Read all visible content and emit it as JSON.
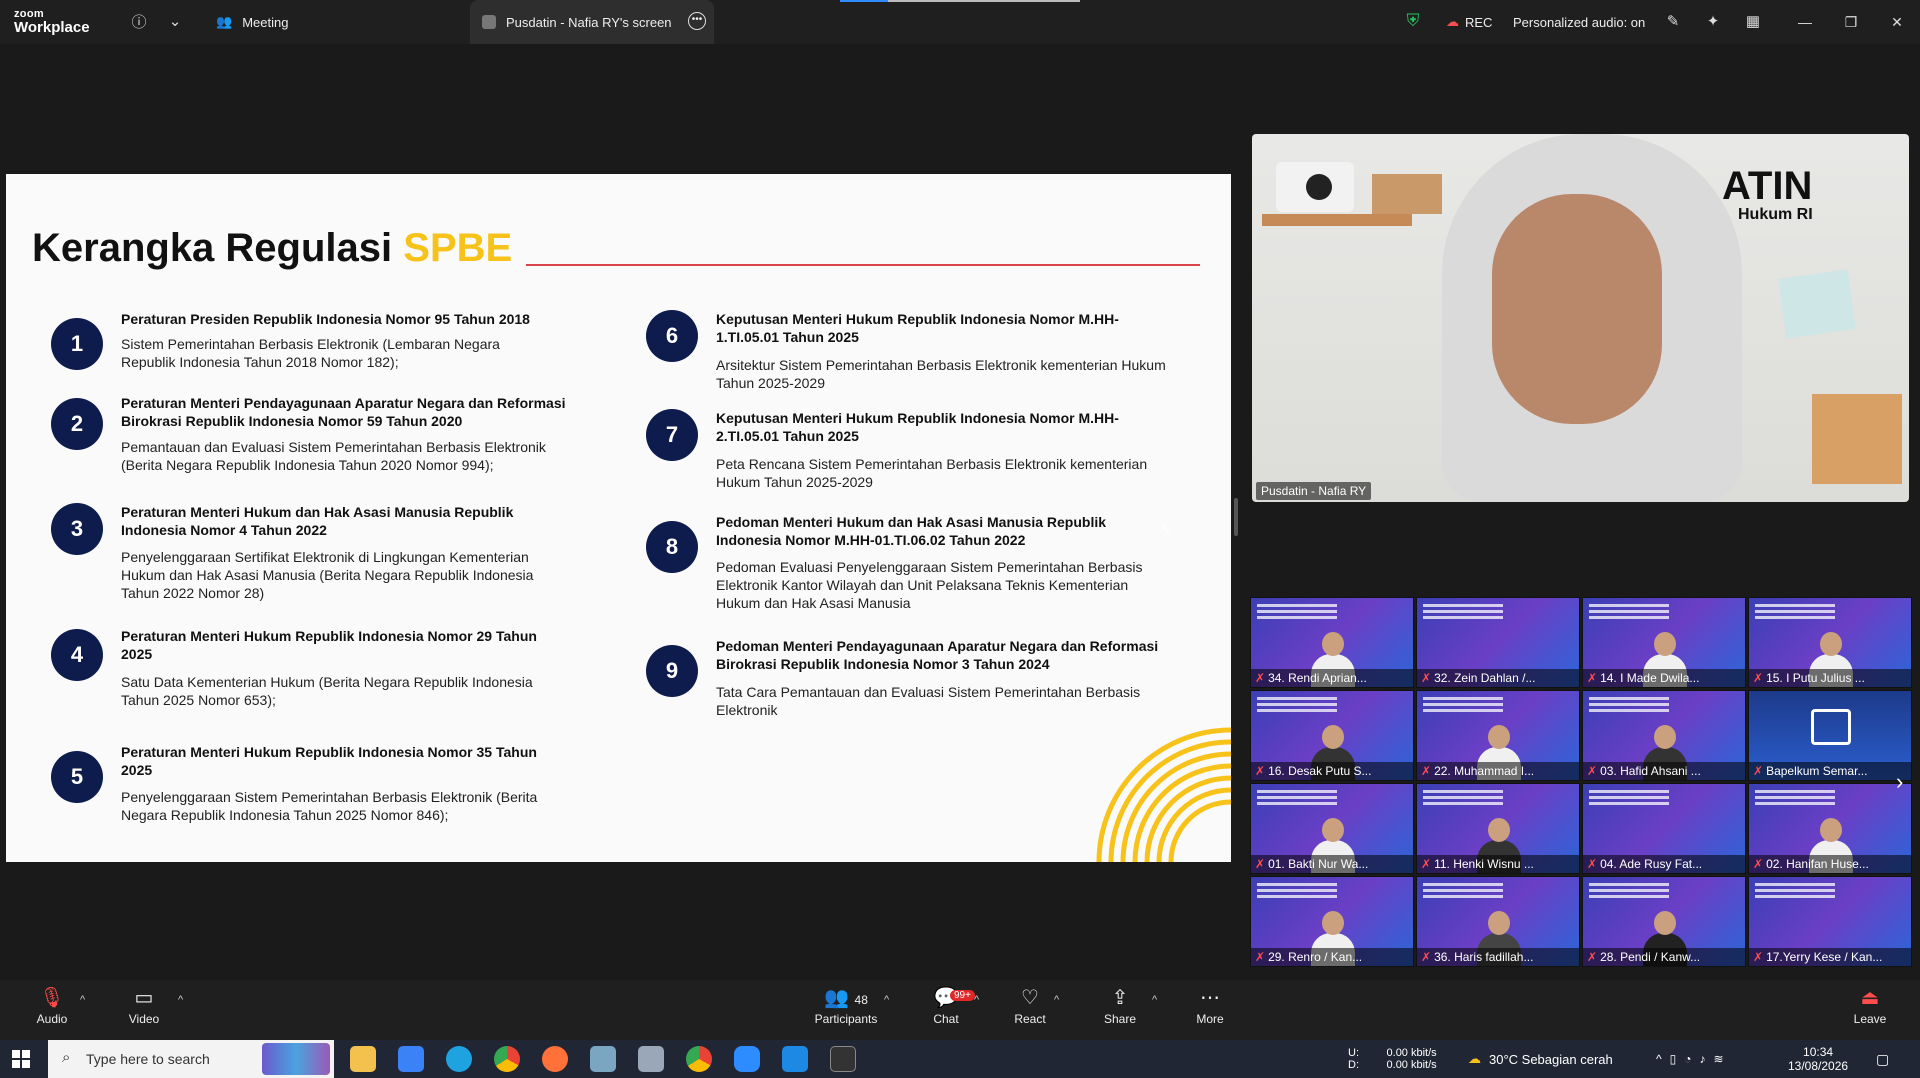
{
  "app": {
    "logo_line1": "zoom",
    "logo_line2": "Workplace",
    "tab_meeting": "Meeting",
    "tab_screen": "Pusdatin - Nafia RY's screen",
    "rec_label": "REC",
    "audio_status": "Personalized audio: on"
  },
  "slide": {
    "title_part1": "Kerangka Regulasi",
    "title_highlight": "SPBE",
    "items": [
      {
        "num": "1",
        "title": "Peraturan Presiden Republik Indonesia Nomor 95 Tahun 2018",
        "desc": "Sistem Pemerintahan Berbasis Elektronik (Lembaran Negara Republik Indonesia Tahun 2018 Nomor 182);"
      },
      {
        "num": "2",
        "title": "Peraturan Menteri Pendayagunaan Aparatur Negara dan Reformasi Birokrasi Republik Indonesia Nomor 59 Tahun 2020",
        "desc": "Pemantauan dan Evaluasi Sistem Pemerintahan Berbasis Elektronik (Berita Negara Republik Indonesia Tahun 2020 Nomor 994);"
      },
      {
        "num": "3",
        "title": "Peraturan Menteri Hukum dan Hak Asasi Manusia Republik Indonesia Nomor 4 Tahun 2022",
        "desc": "Penyelenggaraan Sertifikat Elektronik di Lingkungan Kementerian Hukum dan Hak Asasi Manusia (Berita Negara Republik Indonesia Tahun 2022 Nomor 28)"
      },
      {
        "num": "4",
        "title": "Peraturan Menteri Hukum Republik Indonesia Nomor 29 Tahun 2025",
        "desc": "Satu Data Kementerian Hukum (Berita Negara Republik Indonesia Tahun 2025 Nomor 653);"
      },
      {
        "num": "5",
        "title": "Peraturan Menteri Hukum Republik Indonesia Nomor 35 Tahun 2025",
        "desc": "Penyelenggaraan Sistem Pemerintahan Berbasis Elektronik (Berita Negara Republik Indonesia Tahun 2025 Nomor 846);"
      },
      {
        "num": "6",
        "title": "Keputusan Menteri Hukum Republik Indonesia Nomor M.HH-1.TI.05.01 Tahun 2025",
        "desc": "Arsitektur Sistem Pemerintahan Berbasis Elektronik kementerian Hukum Tahun 2025-2029"
      },
      {
        "num": "7",
        "title": "Keputusan Menteri Hukum Republik Indonesia Nomor M.HH-2.TI.05.01 Tahun 2025",
        "desc": "Peta Rencana Sistem Pemerintahan Berbasis Elektronik kementerian Hukum Tahun 2025-2029"
      },
      {
        "num": "8",
        "title": "Pedoman Menteri Hukum dan Hak Asasi Manusia Republik Indonesia Nomor M.HH-01.TI.06.02 Tahun 2022",
        "desc": "Pedoman Evaluasi Penyelenggaraan Sistem Pemerintahan Berbasis Elektronik Kantor Wilayah dan Unit Pelaksana Teknis Kementerian Hukum dan Hak Asasi Manusia"
      },
      {
        "num": "9",
        "title": "Pedoman Menteri Pendayagunaan Aparatur Negara dan Reformasi Birokrasi Republik Indonesia Nomor 3 Tahun 2024",
        "desc": "Tata Cara Pemantauan dan Evaluasi Sistem Pemerintahan Berbasis Elektronik"
      }
    ]
  },
  "speaker": {
    "name": "Pusdatin - Nafia RY",
    "bg_text1": "ATIN",
    "bg_text2": "Hukum RI"
  },
  "gallery": {
    "tiles": [
      "34. Rendi Aprian...",
      "32. Zein Dahlan /...",
      "14. I Made Dwila...",
      "15. I Putu Julius ...",
      "16. Desak Putu S...",
      "22. Muhammad I...",
      "03. Hafid Ahsani ...",
      "Bapelkum Semar...",
      "01. Bakti Nur Wa...",
      "11. Henki Wisnu ...",
      "04. Ade Rusy Fat...",
      "02. Hanifan Huse...",
      "29. Renro / Kan...",
      "36. Haris fadillah...",
      "28. Pendi / Kanw...",
      "17.Yerry Kese / Kan..."
    ]
  },
  "toolbar": {
    "audio": "Audio",
    "video": "Video",
    "participants": "Participants",
    "participants_count": "48",
    "chat": "Chat",
    "chat_badge": "99+",
    "react": "React",
    "share": "Share",
    "more": "More",
    "leave": "Leave"
  },
  "taskbar": {
    "search_placeholder": "Type here to search",
    "net_up_label": "U:",
    "net_down_label": "D:",
    "net_up": "0.00 kbit/s",
    "net_down": "0.00 kbit/s",
    "weather": "30°C  Sebagian cerah",
    "time": "10:34",
    "date": "13/08/2026"
  },
  "colors": {
    "accent_yellow": "#f7c21a",
    "number_circle": "#0e1b4d",
    "title_line": "#d9434b",
    "zoom_blue": "#2d8cff"
  }
}
